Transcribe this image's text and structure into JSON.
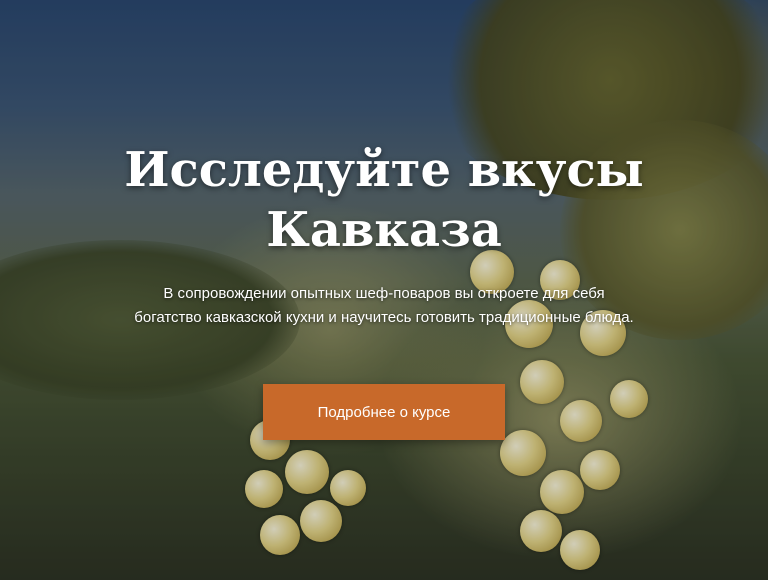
{
  "hero": {
    "title": "Исследуйте вкусы Кавказа",
    "subtitle": "В сопровождении опытных шеф-поваров вы откроете для себя богатство кавказской кухни и научитесь готовить традиционные блюда.",
    "cta_label": "Подробнее о курсе",
    "accent_color": "#c8692a"
  }
}
